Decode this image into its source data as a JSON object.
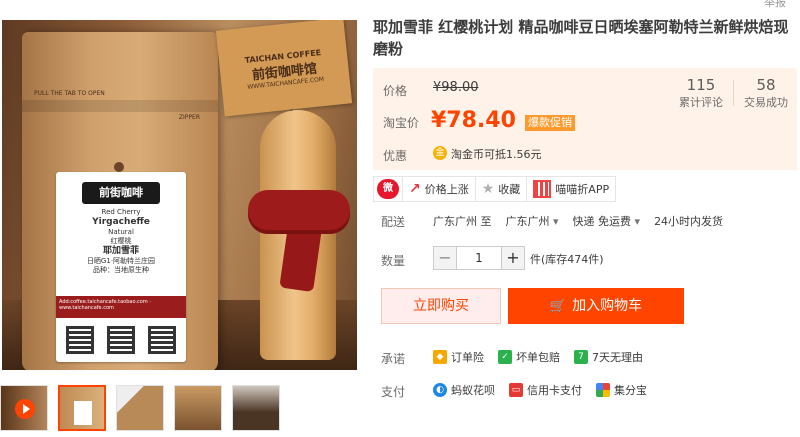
{
  "header": {
    "report_link": "举报"
  },
  "product": {
    "title": "耶加雪菲 红樱桃计划 精品咖啡豆日晒埃塞阿勒特兰新鲜烘焙现磨粉"
  },
  "pricing": {
    "price_label": "价格",
    "original_price": "¥98.00",
    "sale_label": "淘宝价",
    "sale_price": "¥78.40",
    "promo_badge": "爆款促销",
    "discount_label": "优惠",
    "coin_text": "淘金币可抵1.56元",
    "stats": [
      {
        "value": "115",
        "caption": "累计评论"
      },
      {
        "value": "58",
        "caption": "交易成功"
      }
    ]
  },
  "share_bar": {
    "weibo_icon": "weibo-icon",
    "price_alert": "价格上涨",
    "favorite": "收藏",
    "app": "喵喵折APP"
  },
  "shipping": {
    "label": "配送",
    "from": "广东广州 至",
    "to": "广东广州",
    "fee": "快递 免运费",
    "time": "24小时内发货"
  },
  "quantity": {
    "label": "数量",
    "minus": "−",
    "value": "1",
    "plus": "+",
    "stock": "件(库存474件)"
  },
  "actions": {
    "buy_now": "立即购买",
    "add_to_cart": "加入购物车"
  },
  "guarantee": {
    "label": "承诺",
    "items": [
      "订单险",
      "坏单包赔",
      "7天无理由"
    ]
  },
  "payment": {
    "label": "支付",
    "items": [
      "蚂蚁花呗",
      "信用卡支付",
      "集分宝"
    ]
  },
  "photo": {
    "flag_en": "TAICHAN COFFEE",
    "flag_cn": "前街咖啡馆",
    "flag_url": "WWW.TAICHANCAFE.COM",
    "bag_tear": "PULL THE TAB TO OPEN",
    "bag_zip": "ZIPPER",
    "label_logo": "前街咖啡",
    "label_lines": [
      "Red Cherry",
      "Yirgacheffe",
      "Natural",
      "红樱桃",
      "耶加雪菲",
      "日晒G1·阿勒特兰庄园",
      "品种：当地原生种"
    ],
    "label_band": "Add:coffee.taichancafe.taobao.com · www.taichancafe.com"
  },
  "colors": {
    "accent": "#ff4400",
    "price_bg": "#fff2e8",
    "promo": "#ff9b2e"
  }
}
